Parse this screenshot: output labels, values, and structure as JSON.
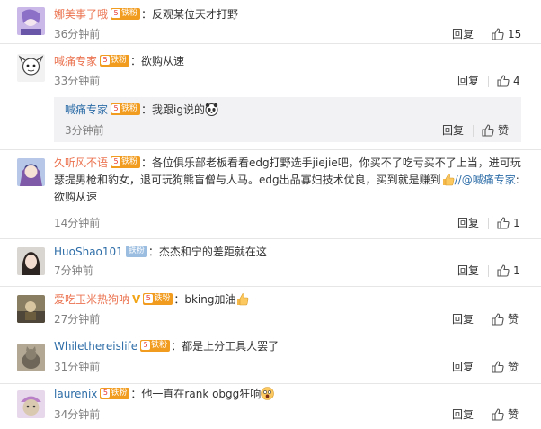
{
  "comments": [
    {
      "user": "娜美事了哦",
      "badge": "铁粉",
      "sep": "：",
      "text": "反观某位天才打野",
      "time": "36分钟前",
      "reply": "回复",
      "like_count": "15"
    },
    {
      "user": "喊痛专家",
      "badge": "铁粉",
      "sep": "：",
      "text": "欲购从速",
      "time": "33分钟前",
      "reply": "回复",
      "like_count": "4"
    },
    {
      "user": "久听风不语",
      "badge": "铁粉",
      "sep": "：",
      "text": "各位俱乐部老板看看edg打野选手jiejie吧，你买不了吃亏买不了上当，进可玩瑟提男枪和豹女，退可玩狗熊盲僧与人马。edg出品寡妇技术优良，买到就是赚到",
      "mention": "//@喊痛专家",
      "mention_sep": ":",
      "text2": "欲购从速",
      "time": "14分钟前",
      "reply": "回复",
      "like_count": "1"
    },
    {
      "user": "HuoShao101",
      "badge": "铁粉",
      "sep": "：",
      "text": "杰杰和宁的差距就在这",
      "time": "7分钟前",
      "reply": "回复",
      "like_count": "1"
    },
    {
      "user": "爱吃玉米热狗呐",
      "badge": "铁粉",
      "sep": "：",
      "text": "bking加油",
      "time": "27分钟前",
      "reply": "回复",
      "like_label": "赞"
    },
    {
      "user": "Whilethereislife",
      "badge": "铁粉",
      "sep": "：",
      "text": "都是上分工具人罢了",
      "time": "31分钟前",
      "reply": "回复",
      "like_label": "赞"
    },
    {
      "user": "laurenix",
      "badge": "铁粉",
      "sep": "：",
      "text": "他一直在rank obgg狂响",
      "time": "34分钟前",
      "reply": "回复",
      "like_label": "赞"
    }
  ],
  "nested_reply": {
    "user": "喊痛专家",
    "badge": "铁粉",
    "sep": "：",
    "text": "我跟ig说的",
    "time": "3分钟前",
    "reply": "回复",
    "like_label": "赞"
  },
  "badge_level": "5",
  "icons": {
    "like": "thumbs-up-icon",
    "emoji": "thumbs-up-emoji",
    "vip": "v-verified-icon"
  },
  "colors": {
    "username": "#eb7350",
    "link": "#2f6ea8",
    "badge": "#f29c1f",
    "badge_blue": "#9bbde0",
    "time": "#808080"
  }
}
